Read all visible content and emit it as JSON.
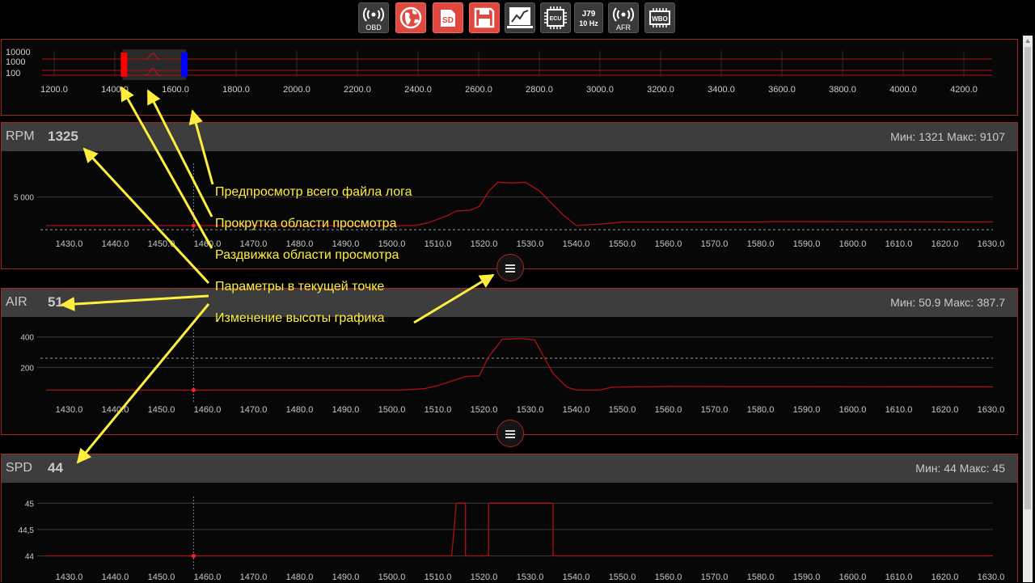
{
  "toolbar": {
    "buttons": [
      {
        "icon": "obd-icon",
        "label": "OBD"
      },
      {
        "icon": "globe-icon",
        "label": ""
      },
      {
        "icon": "sd-card-icon",
        "label": "SD"
      },
      {
        "icon": "save-icon",
        "label": ""
      },
      {
        "icon": "chart-icon",
        "label": ""
      },
      {
        "icon": "ecu-chip-icon",
        "label": "ECU"
      },
      {
        "icon": "j79-icon",
        "label": "J79",
        "sublabel": "10 Hz"
      },
      {
        "icon": "afr-icon",
        "label": "AFR"
      },
      {
        "icon": "wbo-icon",
        "label": "WBO"
      }
    ]
  },
  "overview": {
    "y_ticks": [
      "10000",
      "1000",
      "100"
    ],
    "x_ticks": [
      "1200.0",
      "1400.0",
      "1600.0",
      "1800.0",
      "2000.0",
      "2200.0",
      "2400.0",
      "2600.0",
      "2800.0",
      "3000.0",
      "3200.0",
      "3400.0",
      "3600.0",
      "3800.0",
      "4000.0",
      "4200.0"
    ],
    "x_range": [
      1200,
      4200
    ],
    "window_start": 1425,
    "window_end": 1635,
    "colors": {
      "left_handle": "#ff0000",
      "right_handle": "#0000ff"
    }
  },
  "x_ticks": [
    "1430.0",
    "1440.0",
    "1450.0",
    "1460.0",
    "1470.0",
    "1480.0",
    "1490.0",
    "1500.0",
    "1510.0",
    "1520.0",
    "1530.0",
    "1540.0",
    "1550.0",
    "1560.0",
    "1570.0",
    "1580.0",
    "1590.0",
    "1600.0",
    "1610.0",
    "1620.0",
    "1630.0"
  ],
  "panels": [
    {
      "name": "RPM",
      "value": "1325",
      "minmax": "Мин: 1321    Макс: 9107",
      "y_ticks": [
        "5 000"
      ]
    },
    {
      "name": "AIR",
      "value": "51",
      "minmax": "Мин: 50.9    Макс: 387.7",
      "y_ticks": [
        "400",
        "200"
      ]
    },
    {
      "name": "SPD",
      "value": "44",
      "minmax": "Мин: 44    Макс: 45",
      "y_ticks": [
        "45",
        "44,5",
        "44"
      ]
    }
  ],
  "chart_data": [
    {
      "type": "line",
      "title": "RPM",
      "x": [
        1425,
        1505,
        1508,
        1512,
        1514,
        1517,
        1519,
        1521,
        1523,
        1526,
        1529,
        1532,
        1537,
        1540,
        1546,
        1550,
        1580,
        1583,
        1635
      ],
      "values": [
        1325,
        1325,
        1700,
        2600,
        3200,
        3300,
        3800,
        5700,
        6900,
        6800,
        6900,
        5800,
        2800,
        1325,
        1550,
        1800,
        1800,
        1850,
        1800
      ],
      "cursor_x": 1457
    },
    {
      "type": "line",
      "title": "AIR",
      "x": [
        1425,
        1502,
        1507,
        1510,
        1514,
        1516,
        1519,
        1521,
        1524,
        1528,
        1531,
        1535,
        1538,
        1540,
        1545,
        1548,
        1560,
        1635
      ],
      "values": [
        51,
        51,
        60,
        80,
        120,
        140,
        145,
        270,
        385,
        390,
        380,
        160,
        70,
        51,
        51,
        70,
        75,
        72
      ],
      "cursor_x": 1457
    },
    {
      "type": "line",
      "title": "SPD",
      "x": [
        1425,
        1513,
        1514,
        1516,
        1516,
        1518,
        1518,
        1521,
        1521,
        1535,
        1535,
        1635
      ],
      "values": [
        44,
        44,
        45,
        45,
        44,
        44,
        44,
        44,
        45,
        45,
        44,
        44
      ],
      "cursor_x": 1457
    }
  ],
  "annotations": [
    "Предпросмотр всего файла лога",
    "Прокрутка области просмотра",
    "Раздвижка области просмотра",
    "Параметры в текущей точке",
    "Изменение высоты графика"
  ]
}
